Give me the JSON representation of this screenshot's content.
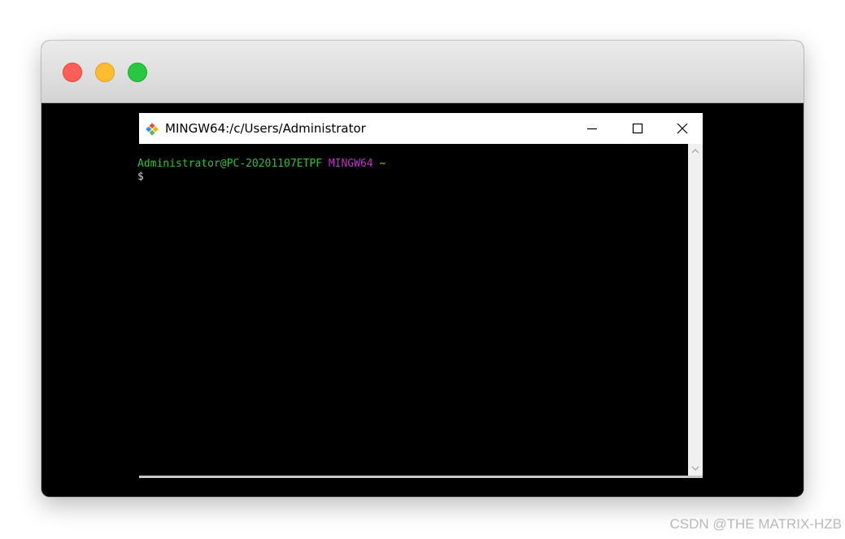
{
  "window": {
    "controls": [
      "close",
      "minimize",
      "zoom"
    ]
  },
  "terminal_window": {
    "title": "MINGW64:/c/Users/Administrator",
    "icon": "git-logo-icon",
    "controls": [
      "minimize",
      "maximize",
      "close"
    ]
  },
  "terminal": {
    "user_host": "Administrator@PC-20201107ETPF",
    "env": "MINGW64",
    "path": "~",
    "prompt_symbol": "$"
  },
  "colors": {
    "prompt_user": "#2fbf3b",
    "prompt_env": "#b935c4",
    "prompt_path": "#c8b632",
    "terminal_bg": "#000000"
  },
  "watermark": "CSDN @THE MATRIX-HZB"
}
